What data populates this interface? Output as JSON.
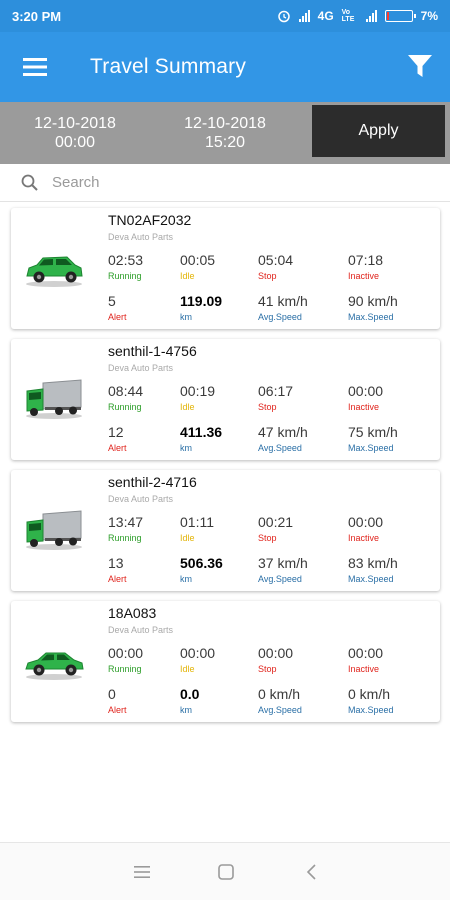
{
  "status_bar": {
    "time": "3:20 PM",
    "network": "4G",
    "volte": "Vo LTE",
    "battery": "7%",
    "battery_level": 0.07
  },
  "app_bar": {
    "title": "Travel Summary"
  },
  "date_range": {
    "from_date": "12-10-2018",
    "from_time": "00:00",
    "to_date": "12-10-2018",
    "to_time": "15:20",
    "apply_label": "Apply"
  },
  "search": {
    "placeholder": "Search"
  },
  "labels": {
    "running": "Running",
    "idle": "Idle",
    "stop": "Stop",
    "inactive": "Inactive",
    "alert": "Alert",
    "km": "km",
    "avg_speed": "Avg.Speed",
    "max_speed": "Max.Speed"
  },
  "colors": {
    "app_bar": "#3296e6",
    "status_bar": "#2d8fdc",
    "running": "#2e9e2a",
    "idle": "#e3b50a",
    "stop": "#e0241d",
    "speed": "#2a6fa6",
    "vehicle": "#2fb34a"
  },
  "vehicles": [
    {
      "name": "TN02AF2032",
      "company": "Deva Auto Parts",
      "icon": "car-suv-icon",
      "running": "02:53",
      "idle": "00:05",
      "stop": "05:04",
      "inactive": "07:18",
      "alert": "5",
      "km": "119.09",
      "avg_speed": "41 km/h",
      "max_speed": "90 km/h"
    },
    {
      "name": "senthil-1-4756",
      "company": "Deva Auto Parts",
      "icon": "truck-icon",
      "running": "08:44",
      "idle": "00:19",
      "stop": "06:17",
      "inactive": "00:00",
      "alert": "12",
      "km": "411.36",
      "avg_speed": "47 km/h",
      "max_speed": "75 km/h"
    },
    {
      "name": "senthil-2-4716",
      "company": "Deva Auto Parts",
      "icon": "truck-icon",
      "running": "13:47",
      "idle": "01:11",
      "stop": "00:21",
      "inactive": "00:00",
      "alert": "13",
      "km": "506.36",
      "avg_speed": "37 km/h",
      "max_speed": "83 km/h"
    },
    {
      "name": "18A083",
      "company": "Deva Auto Parts",
      "icon": "car-sedan-icon",
      "running": "00:00",
      "idle": "00:00",
      "stop": "00:00",
      "inactive": "00:00",
      "alert": "0",
      "km": "0.0",
      "avg_speed": "0 km/h",
      "max_speed": "0 km/h"
    }
  ],
  "nav_bar": {
    "buttons": [
      "menu-nav-icon",
      "home-nav-icon",
      "back-nav-icon"
    ]
  }
}
